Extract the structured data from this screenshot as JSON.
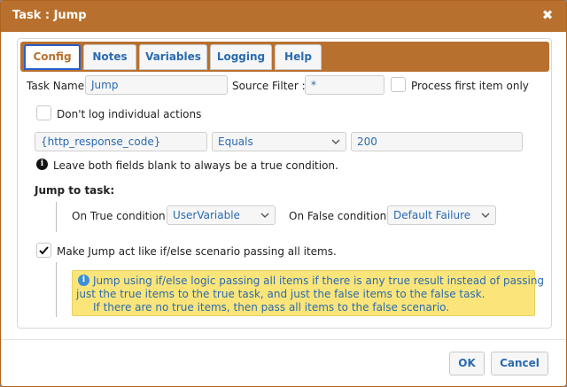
{
  "dialog": {
    "title": "Task : Jump",
    "close_glyph": "✖"
  },
  "tabs": [
    {
      "label": "Config",
      "active": true
    },
    {
      "label": "Notes",
      "active": false
    },
    {
      "label": "Variables",
      "active": false
    },
    {
      "label": "Logging",
      "active": false
    },
    {
      "label": "Help",
      "active": false
    }
  ],
  "config": {
    "task_name_label": "Task Name:",
    "task_name_value": "Jump",
    "source_filter_label": "Source Filter :",
    "source_filter_value": "*",
    "process_first_label": "Process first item only",
    "process_first_checked": false,
    "dont_log_label": "Don't log individual actions",
    "dont_log_checked": false,
    "condition": {
      "field": "{http_response_code}",
      "operator": "Equals",
      "value": "200"
    },
    "blank_hint": "Leave both fields blank to always be a true condition.",
    "jump_section_label": "Jump to task:",
    "on_true_label": "On True condition:",
    "on_true_value": "UserVariable",
    "on_false_label": "On False condition:",
    "on_false_value": "Default Failure",
    "ifelse_label": "Make Jump act like if/else scenario passing all items.",
    "ifelse_checked": true,
    "note_lines": [
      "Jump using if/else logic passing all items if there is any true result instead of passing",
      "just the true items to the true task, and just the false items to the false task.",
      "If there are no true items, then pass all items to the false scenario."
    ]
  },
  "footer": {
    "ok_label": "OK",
    "cancel_label": "Cancel"
  },
  "colors": {
    "titlebar": "#b8702e",
    "link_blue": "#2a6ab0",
    "note_bg": "#fbe57a"
  }
}
